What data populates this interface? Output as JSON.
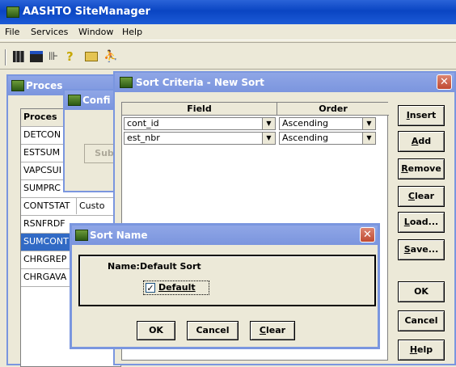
{
  "app": {
    "title": "AASHTO SiteManager"
  },
  "menu": [
    "File",
    "Services",
    "Window",
    "Help"
  ],
  "toolbar_icons": [
    "grid-icon",
    "window-icon",
    "tools-icon",
    "help-icon",
    "folder-icon",
    "run-icon"
  ],
  "process_window": {
    "title": "Proces",
    "header": "Proces",
    "rows": [
      "DETCON",
      "ESTSUM",
      "VAPCSUI",
      "SUMPRC",
      "CONTSTAT",
      "RSNFRDF",
      "SUMCONT",
      "CHRGREP",
      "CHRGAVA"
    ],
    "row_extra": {
      "CONTSTAT": "Custo"
    },
    "selected_row": "SUMCONT"
  },
  "config_window": {
    "title": "Confi",
    "submit_label": "Sub"
  },
  "sort_criteria": {
    "title": "Sort Criteria - New Sort",
    "columns": [
      "Field",
      "Order"
    ],
    "rows": [
      {
        "field": "cont_id",
        "order": "Ascending"
      },
      {
        "field": "est_nbr",
        "order": "Ascending"
      }
    ],
    "buttons": [
      {
        "pre": "",
        "u": "I",
        "post": "nsert"
      },
      {
        "pre": "",
        "u": "A",
        "post": "dd"
      },
      {
        "pre": "",
        "u": "R",
        "post": "emove"
      },
      {
        "pre": "",
        "u": "C",
        "post": "lear"
      },
      {
        "pre": "",
        "u": "L",
        "post": "oad..."
      },
      {
        "pre": "",
        "u": "S",
        "post": "ave..."
      }
    ],
    "ok_label": "OK",
    "cancel_label": "Cancel",
    "help": {
      "pre": "",
      "u": "H",
      "post": "elp"
    }
  },
  "sort_name": {
    "title": "Sort Name",
    "name_label": "Name:",
    "name_value": "Default Sort",
    "default_label": "Default",
    "default_checked": true,
    "ok_label": "OK",
    "cancel_label": "Cancel",
    "clear": {
      "pre": "",
      "u": "C",
      "post": "lear"
    }
  }
}
